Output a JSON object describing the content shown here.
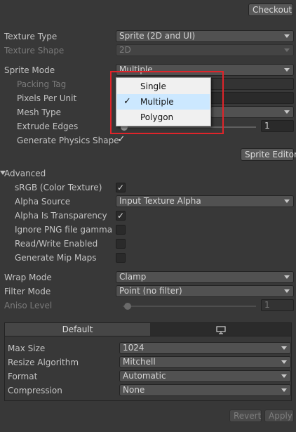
{
  "toolbar": {
    "checkout_label": "Checkout"
  },
  "texture": {
    "type_label": "Texture Type",
    "type_value": "Sprite (2D and UI)",
    "shape_label": "Texture Shape",
    "shape_value": "2D"
  },
  "sprite": {
    "mode_label": "Sprite Mode",
    "mode_value": "Multiple",
    "packing_tag_label": "Packing Tag",
    "ppu_label": "Pixels Per Unit",
    "mesh_type_label": "Mesh Type",
    "extrude_label": "Extrude Edges",
    "extrude_value": "1",
    "physics_label": "Generate Physics Shape",
    "physics_checked": "✓",
    "editor_button": "Sprite Editor"
  },
  "popup": {
    "items": [
      {
        "label": "Single",
        "selected": false
      },
      {
        "label": "Multiple",
        "selected": true
      },
      {
        "label": "Polygon",
        "selected": false
      }
    ],
    "check_glyph": "✓"
  },
  "advanced": {
    "header": "Advanced",
    "srgb_label": "sRGB (Color Texture)",
    "srgb_checked": "✓",
    "alpha_source_label": "Alpha Source",
    "alpha_source_value": "Input Texture Alpha",
    "alpha_transparency_label": "Alpha Is Transparency",
    "alpha_transparency_checked": "✓",
    "ignore_png_label": "Ignore PNG file gamma",
    "read_write_label": "Read/Write Enabled",
    "mipmaps_label": "Generate Mip Maps"
  },
  "sampling": {
    "wrap_label": "Wrap Mode",
    "wrap_value": "Clamp",
    "filter_label": "Filter Mode",
    "filter_value": "Point (no filter)",
    "aniso_label": "Aniso Level",
    "aniso_value": "1"
  },
  "platform": {
    "tab_default": "Default",
    "max_size_label": "Max Size",
    "max_size_value": "1024",
    "resize_label": "Resize Algorithm",
    "resize_value": "Mitchell",
    "format_label": "Format",
    "format_value": "Automatic",
    "compression_label": "Compression",
    "compression_value": "None"
  },
  "footer": {
    "revert_label": "Revert",
    "apply_label": "Apply"
  },
  "colors": {
    "background": "#383838",
    "popup_highlight": "#cce8ff",
    "callout": "#e0242a"
  }
}
